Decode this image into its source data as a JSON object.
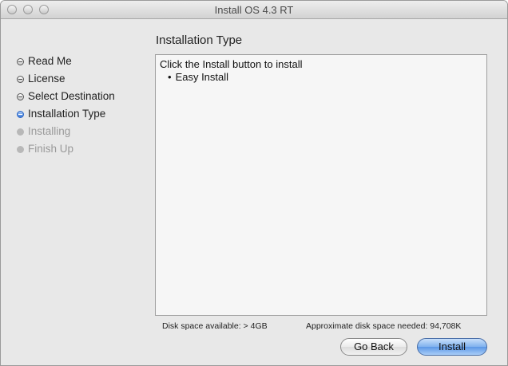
{
  "window": {
    "title": "Install OS 4.3 RT"
  },
  "section_title": "Installation Type",
  "steps": [
    {
      "label": "Read Me",
      "state": "done"
    },
    {
      "label": "License",
      "state": "done"
    },
    {
      "label": "Select Destination",
      "state": "done"
    },
    {
      "label": "Installation Type",
      "state": "current"
    },
    {
      "label": "Installing",
      "state": "disabled"
    },
    {
      "label": "Finish Up",
      "state": "disabled"
    }
  ],
  "content": {
    "instruction": "Click the Install button to install",
    "items": [
      "Easy Install"
    ]
  },
  "disk": {
    "available": "Disk space available: > 4GB",
    "needed": "Approximate disk space needed: 94,708K"
  },
  "buttons": {
    "go_back": "Go Back",
    "install": "Install"
  },
  "colors": {
    "accent": "#3a78d8",
    "window_bg": "#e8e8e8"
  }
}
